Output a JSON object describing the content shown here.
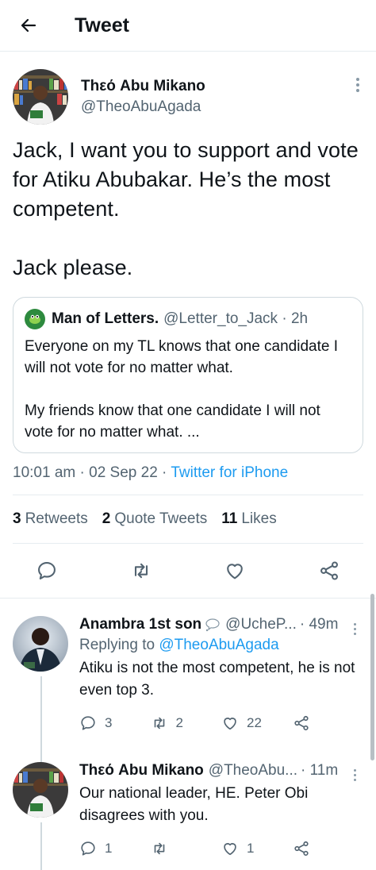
{
  "header": {
    "title": "Tweet"
  },
  "tweet": {
    "author_name": "Thεό Abu Mikano",
    "author_handle": "@TheoAbuAgada",
    "body_line1": "Jack, I want you to support and vote for Atiku Abubakar. He’s the most competent.",
    "body_line2": "Jack please.",
    "quote": {
      "name": "Man of Letters.",
      "handle": "@Letter_to_Jack",
      "time": "2h",
      "text1": "Everyone on my TL knows that one candidate I will not vote for no matter what.",
      "text2": "My friends know that one candidate I will not vote for no matter what. ..."
    },
    "time": "10:01 am",
    "date": "02 Sep 22",
    "source": "Twitter for iPhone",
    "stats": {
      "retweets_count": "3",
      "retweets_label": "Retweets",
      "quotes_count": "2",
      "quotes_label": "Quote Tweets",
      "likes_count": "11",
      "likes_label": "Likes"
    }
  },
  "replies": [
    {
      "name": "Anambra 1st son",
      "handle": "@UcheP...",
      "time": "49m",
      "replying_label": "Replying to",
      "replying_to": "@TheoAbuAgada",
      "text": "Atiku is not the most competent, he is not even top 3.",
      "replies": "3",
      "retweets": "2",
      "likes": "22"
    },
    {
      "name": "Thεό Abu Mikano",
      "handle": "@TheoAbu...",
      "time": "11m",
      "text": "Our national leader, HE. Peter Obi disagrees with you.",
      "replies": "1",
      "retweets": "",
      "likes": "1"
    }
  ],
  "colors": {
    "accent": "#1d9bf0",
    "muted": "#536471",
    "border": "#e6ecf0"
  }
}
